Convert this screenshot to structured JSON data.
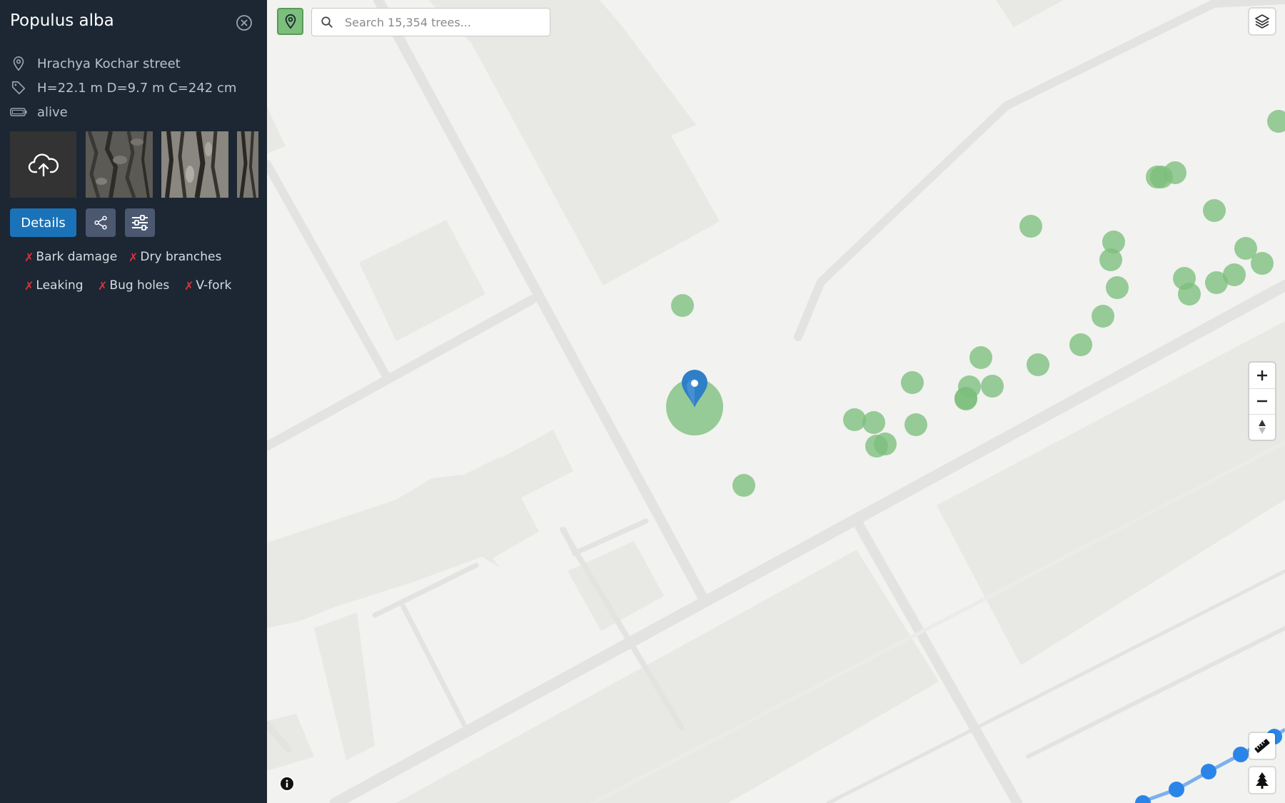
{
  "sidebar": {
    "title": "Populus alba",
    "close_icon": "close-circle-icon",
    "address": "Hrachya Kochar street",
    "measurements": "H=22.1 m D=9.7 m C=242 cm",
    "status": "alive",
    "photos": {
      "upload_icon": "cloud-upload-icon",
      "thumbnails": [
        "bark-photo-1",
        "bark-photo-2",
        "bark-photo-3"
      ]
    },
    "actions": {
      "details_label": "Details",
      "share_icon": "share-icon",
      "settings_icon": "sliders-icon"
    },
    "tags": [
      "Bark damage",
      "Dry branches",
      "Leaking",
      "Bug holes",
      "V-fork"
    ]
  },
  "search": {
    "placeholder": "Search 15,354 trees..."
  },
  "map_controls": {
    "geolocate_icon": "map-pin-icon",
    "layers_icon": "layers-icon",
    "zoom_in_icon": "plus-icon",
    "zoom_out_icon": "minus-icon",
    "compass_icon": "compass-icon",
    "measure_icon": "ruler-icon",
    "tree_icon": "tree-icon",
    "info_icon": "info-icon"
  },
  "colors": {
    "sidebar_bg": "#1c2733",
    "primary_button": "#1a73b8",
    "tree_marker": "#7cbf7c",
    "selected_pin": "#2f7fc8",
    "tag_cross": "#e0303a",
    "measure_line": "#2b85e8"
  }
}
